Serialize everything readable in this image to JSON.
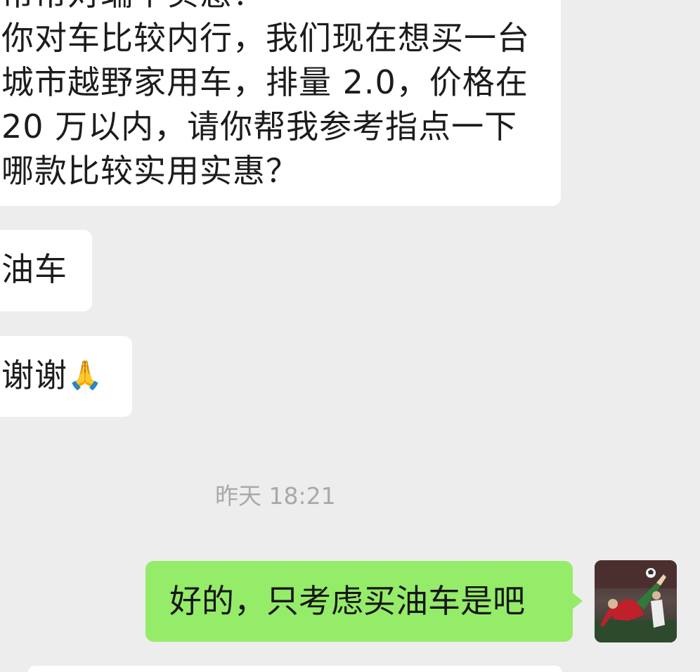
{
  "chat": {
    "messages": [
      {
        "direction": "incoming",
        "lines": [
          "帮帮对端个实惠？",
          "你对车比较内行，我们现在想买一台",
          "城市越野家用车，排量 2.0，价格在",
          "20 万以内，请你帮我参考指点一下",
          "哪款比较实用实惠？"
        ]
      },
      {
        "direction": "incoming",
        "text": "油车"
      },
      {
        "direction": "incoming",
        "text": "谢谢",
        "emoji": "🙏"
      }
    ],
    "timestamp": "昨天 18:21",
    "outgoing": {
      "text": "好的，只考虑买油车是吧"
    }
  },
  "colors": {
    "background": "#ededed",
    "incoming_bubble": "#ffffff",
    "outgoing_bubble": "#95ec69",
    "timestamp": "#a9a9a9"
  },
  "icons": {
    "pray_emoji": "folded-hands-icon",
    "avatar": "user-avatar"
  }
}
